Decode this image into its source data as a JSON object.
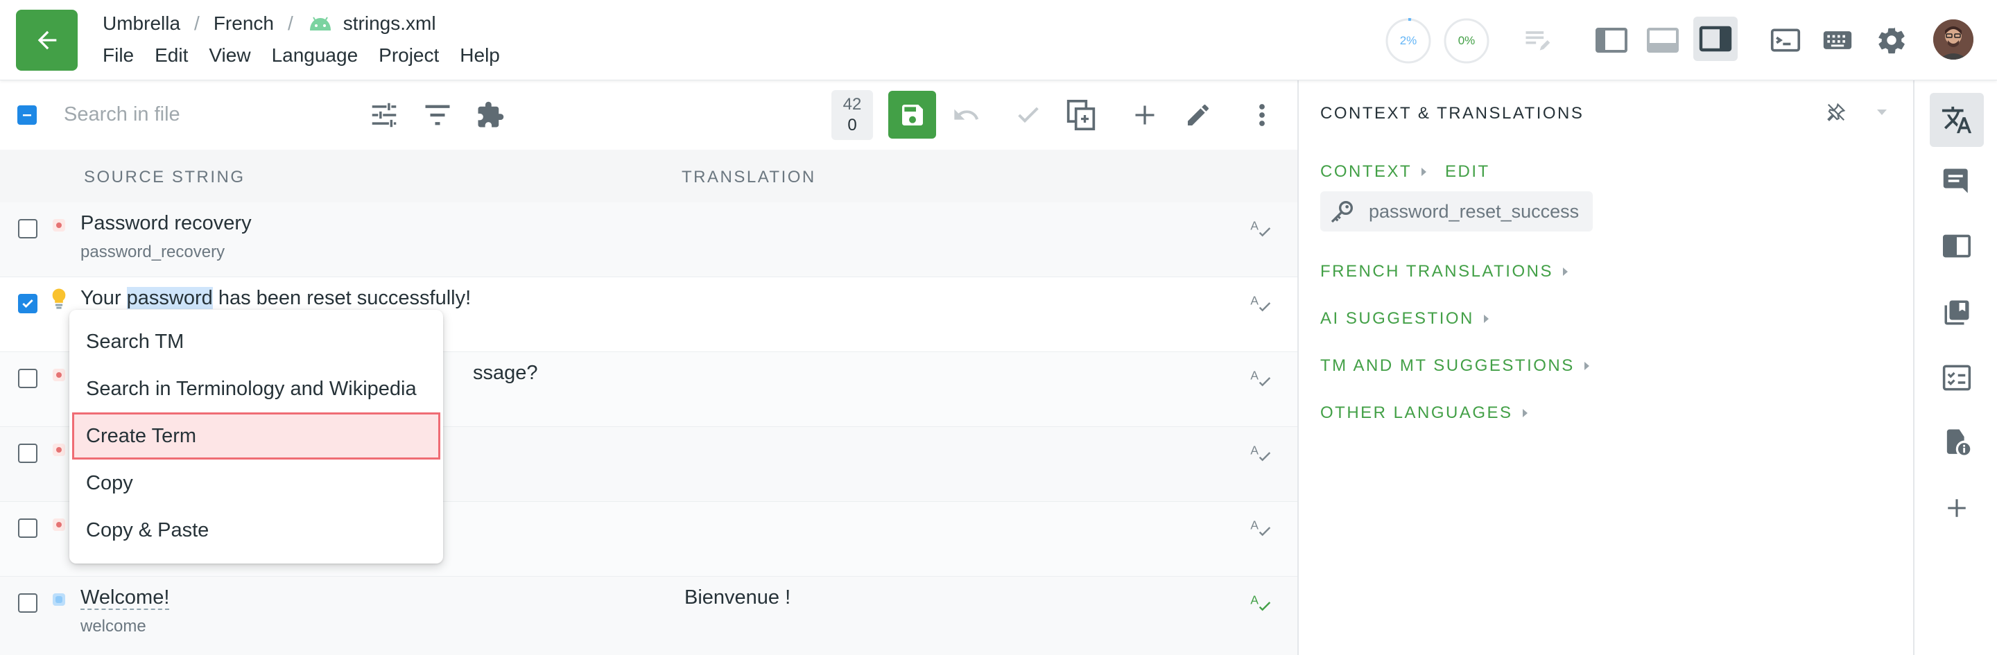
{
  "breadcrumb": {
    "project": "Umbrella",
    "language": "French",
    "file": "strings.xml",
    "separator": "/"
  },
  "menu": [
    "File",
    "Edit",
    "View",
    "Language",
    "Project",
    "Help"
  ],
  "progress": {
    "translated_label": "2%",
    "translated_value": 0.02,
    "approved_label": "0%",
    "approved_value": 0.0
  },
  "search": {
    "placeholder": "Search in file",
    "value": ""
  },
  "counter": {
    "top": "42",
    "bottom": "0"
  },
  "columns": {
    "source": "SOURCE STRING",
    "translation": "TRANSLATION"
  },
  "rows": [
    {
      "source": "Password recovery",
      "key": "password_recovery",
      "translation": "",
      "checked": false
    },
    {
      "source_before": "Your ",
      "source_highlight": "password",
      "source_after": " has been reset successfully!",
      "key": "",
      "translation": "",
      "checked": true
    },
    {
      "source_tail": "ssage?",
      "checked": false
    },
    {
      "checked": false
    },
    {
      "checked": false
    },
    {
      "source": "Welcome!",
      "key": "welcome",
      "translation": "Bienvenue !",
      "checked": false
    }
  ],
  "context_menu": [
    "Search TM",
    "Search in Terminology and Wikipedia",
    "Create Term",
    "Copy",
    "Copy & Paste"
  ],
  "panel": {
    "title": "CONTEXT & TRANSLATIONS",
    "context": "CONTEXT",
    "edit": "EDIT",
    "key": "password_reset_success",
    "sections": [
      "FRENCH TRANSLATIONS",
      "AI SUGGESTION",
      "TM AND MT SUGGESTIONS",
      "OTHER LANGUAGES"
    ]
  },
  "colors": {
    "accent": "#43a047",
    "checkbox": "#1e88e5",
    "menu_highlight_border": "#ef6c74",
    "menu_highlight_fill": "#fde5e6"
  }
}
